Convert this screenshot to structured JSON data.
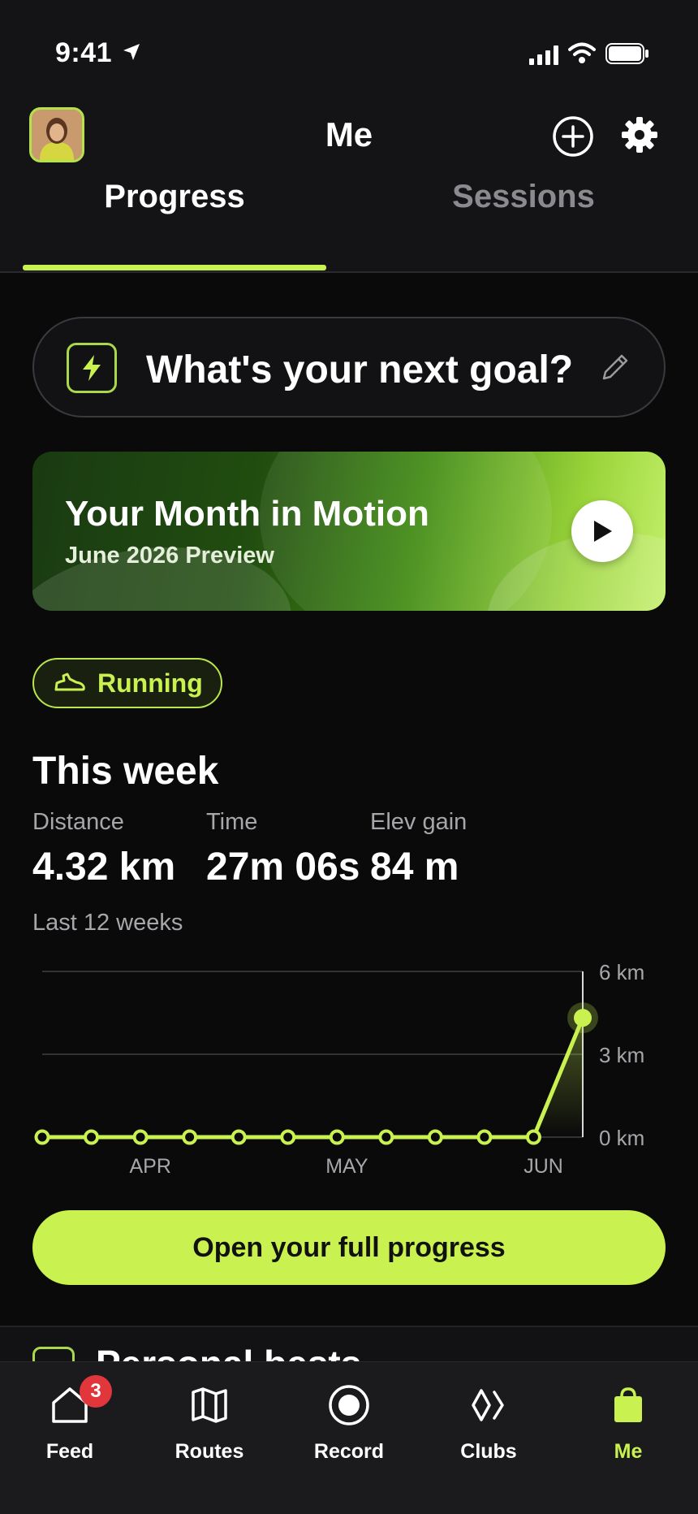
{
  "status_bar": {
    "time": "9:41"
  },
  "header": {
    "title": "Me",
    "tabs": [
      {
        "label": "Progress",
        "active": true
      },
      {
        "label": "Sessions",
        "active": false
      }
    ]
  },
  "goal": {
    "text": "What's your next goal?"
  },
  "banner": {
    "title": "Your Month in Motion",
    "subtitle": "June 2026 Preview"
  },
  "activity_chip": {
    "label": "Running"
  },
  "week": {
    "title": "This week",
    "stats": [
      {
        "label": "Distance",
        "value": "4.32 km"
      },
      {
        "label": "Time",
        "value": "27m 06s"
      },
      {
        "label": "Elev gain",
        "value": "84 m"
      }
    ],
    "chart_caption": "Last 12 weeks"
  },
  "chart_data": {
    "type": "line",
    "x": [
      "w1",
      "w2",
      "w3",
      "w4",
      "w5",
      "w6",
      "w7",
      "w8",
      "w9",
      "w10",
      "w11",
      "w12"
    ],
    "values": [
      0,
      0,
      0,
      0,
      0,
      0,
      0,
      0,
      0,
      0,
      0,
      4.32
    ],
    "ylim": [
      0,
      6
    ],
    "y_ticks": [
      "6 km",
      "3 km",
      "0 km"
    ],
    "x_tick_labels": [
      {
        "label": "APR",
        "index": 2
      },
      {
        "label": "MAY",
        "index": 6
      },
      {
        "label": "JUN",
        "index": 10
      }
    ],
    "color": "#c9f14f"
  },
  "cta": {
    "label": "Open your full progress"
  },
  "peek": {
    "title": "Personal bests"
  },
  "tabbar": {
    "items": [
      {
        "label": "Feed",
        "badge": "3"
      },
      {
        "label": "Routes"
      },
      {
        "label": "Record"
      },
      {
        "label": "Clubs"
      },
      {
        "label": "Me",
        "active": true
      }
    ]
  },
  "colors": {
    "accent": "#c9f14f",
    "background": "#0a0a0b",
    "badge": "#e0363c"
  }
}
